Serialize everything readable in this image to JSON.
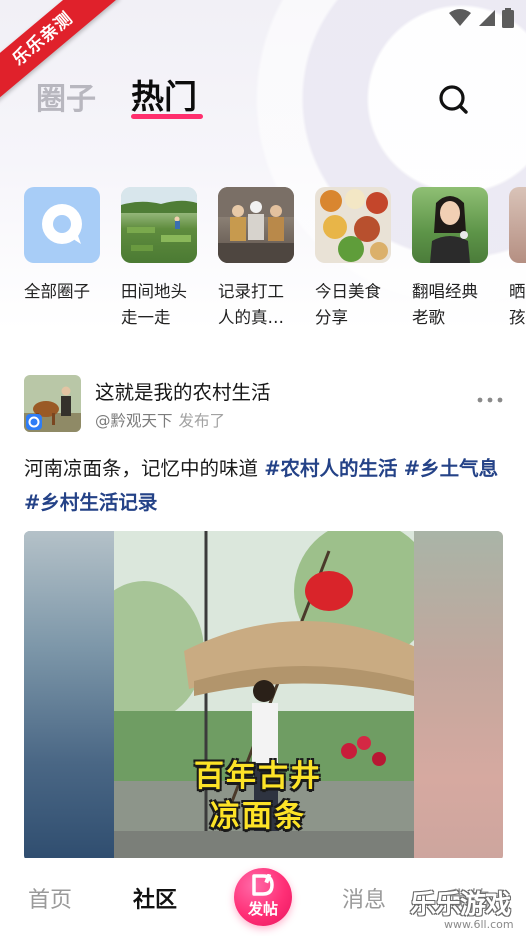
{
  "header": {
    "tabs": [
      {
        "label": "圈子",
        "active": false
      },
      {
        "label": "热门",
        "active": true
      }
    ],
    "search_icon": "search-icon",
    "accent_color": "#ff2f6e"
  },
  "ribbon": {
    "text": "乐乐亲测"
  },
  "circles": [
    {
      "label": "全部圈子"
    },
    {
      "label": "田间地头\n走一走"
    },
    {
      "label": "记录打工\n人的真…"
    },
    {
      "label": "今日美食\n分享"
    },
    {
      "label": "翻唱经典\n老歌"
    },
    {
      "label": "晒\n孩"
    }
  ],
  "post": {
    "title": "这就是我的农村生活",
    "author": "@黔观天下",
    "action": "发布了",
    "text": "河南凉面条，记忆中的味道 ",
    "tags": [
      "#农村人的生活",
      "#乡土气息",
      "#乡村生活记录"
    ],
    "video_caption_line1": "百年古井",
    "video_caption_line2": "凉面条"
  },
  "bottom_nav": {
    "items": [
      {
        "label": "首页",
        "active": false
      },
      {
        "label": "社区",
        "active": true
      },
      {
        "label": "消息",
        "active": false
      },
      {
        "label": "我的",
        "active": false
      }
    ],
    "post_button_label": "发帖"
  },
  "watermark": {
    "text": "乐乐游戏",
    "url": "www.6ll.com"
  }
}
